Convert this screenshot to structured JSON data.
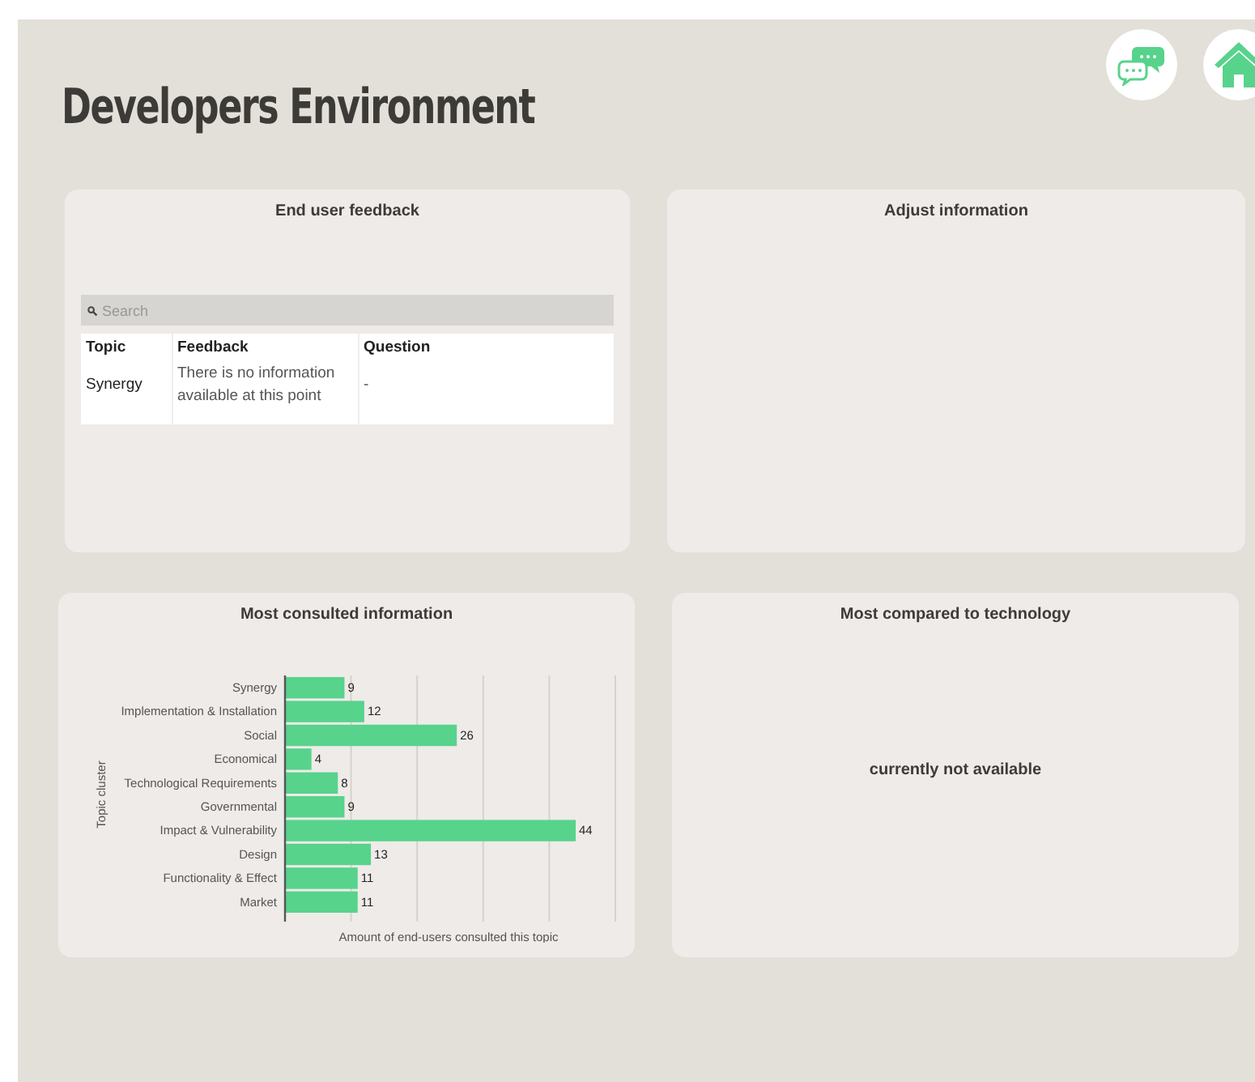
{
  "title": "Developers Environment",
  "header_buttons": [
    {
      "kind": "chat"
    },
    {
      "kind": "home"
    }
  ],
  "feedback_card": {
    "title": "End user feedback",
    "search": {
      "placeholder": "Search"
    },
    "table": {
      "columns": [
        "Topic",
        "Feedback",
        "Question"
      ],
      "rows": [
        [
          "Synergy",
          "There is no information available at this point",
          "-"
        ]
      ]
    }
  },
  "adjust_card": {
    "title": "Adjust information"
  },
  "consulted_card": {
    "title": "Most consulted information",
    "chart_data": {
      "type": "bar",
      "orientation": "horizontal",
      "xlabel": "Amount of end-users consulted this topic",
      "ylabel": "Topic cluster",
      "categories": [
        "Synergy",
        "Implementation & Installation",
        "Social",
        "Economical",
        "Technological Requirements",
        "Governmental",
        "Impact & Vulnerability",
        "Design",
        "Functionality & Effect",
        "Market"
      ],
      "series": [
        {
          "color": "#57d38c",
          "values": [
            9,
            12,
            26,
            4,
            8,
            9,
            44,
            13,
            11,
            11
          ]
        }
      ],
      "xlim": [
        0,
        50
      ],
      "data_labels": true
    }
  },
  "compared_card": {
    "title": "Most compared to technology",
    "message": "currently not available"
  }
}
